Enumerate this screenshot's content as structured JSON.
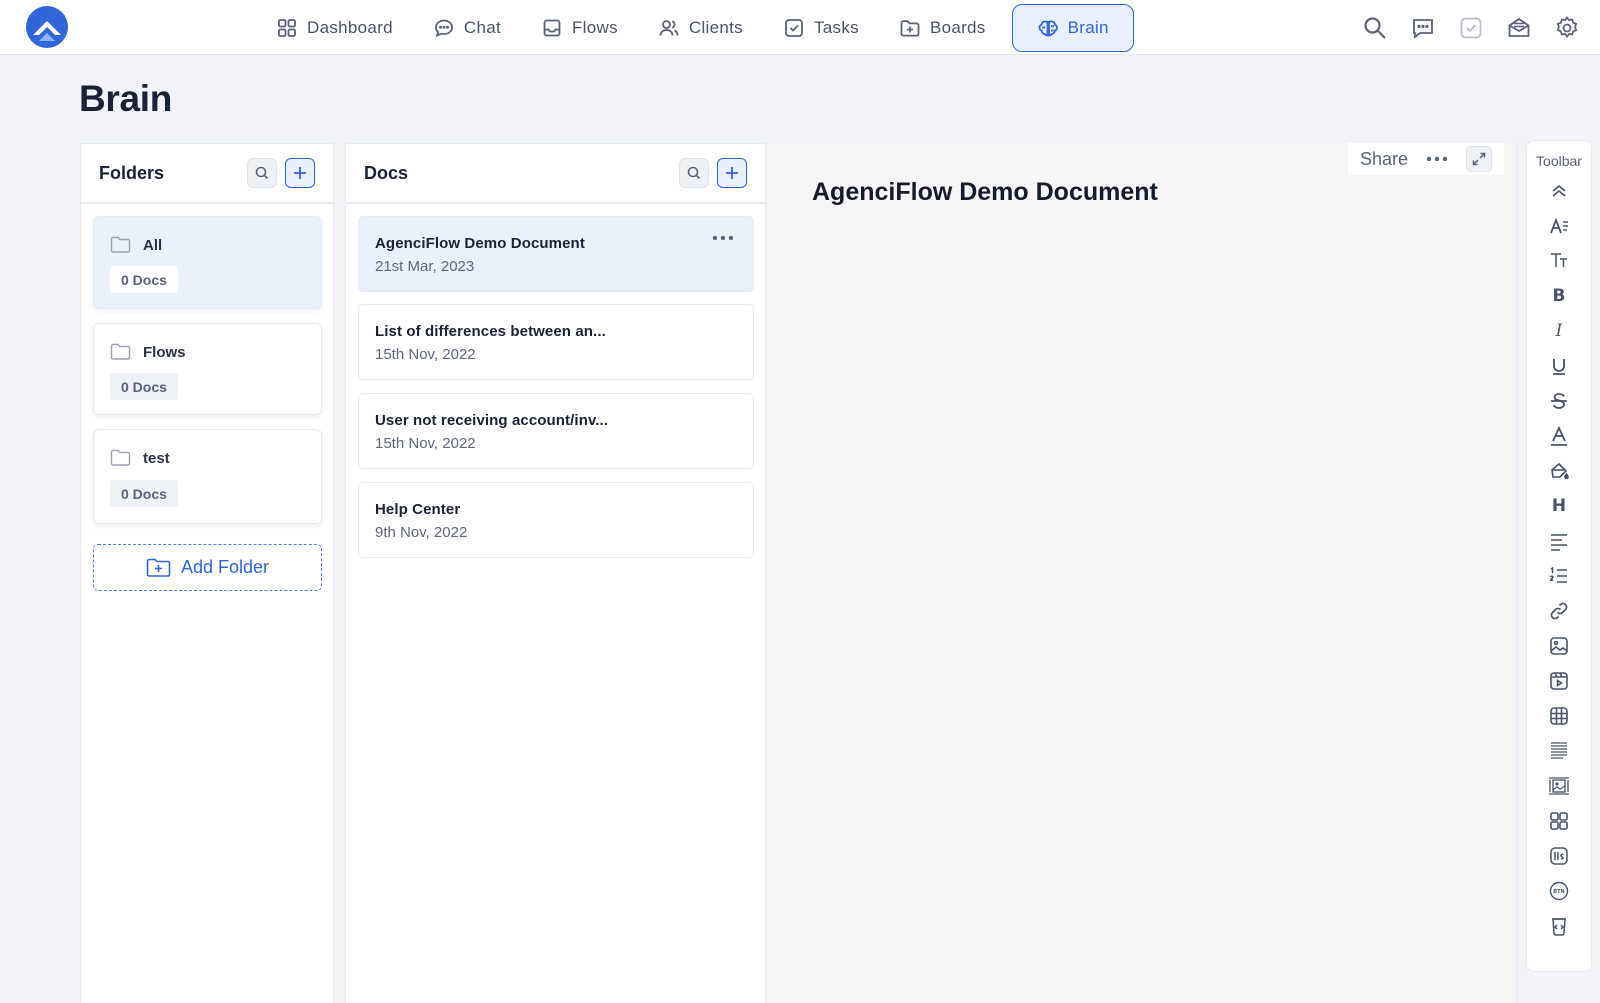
{
  "nav": {
    "items": [
      {
        "label": "Dashboard",
        "icon": "grid-icon"
      },
      {
        "label": "Chat",
        "icon": "chat-bubble-icon"
      },
      {
        "label": "Flows",
        "icon": "inbox-icon"
      },
      {
        "label": "Clients",
        "icon": "users-icon"
      },
      {
        "label": "Tasks",
        "icon": "checkbox-icon"
      },
      {
        "label": "Boards",
        "icon": "folder-plus-icon"
      },
      {
        "label": "Brain",
        "icon": "brain-icon",
        "active": true
      }
    ]
  },
  "page": {
    "title": "Brain"
  },
  "folders": {
    "title": "Folders",
    "items": [
      {
        "name": "All",
        "count": "0 Docs",
        "selected": true
      },
      {
        "name": "Flows",
        "count": "0 Docs"
      },
      {
        "name": "test",
        "count": "0 Docs"
      }
    ],
    "add_label": "Add Folder"
  },
  "docs": {
    "title": "Docs",
    "items": [
      {
        "title": "AgenciFlow Demo Document",
        "date": "21st Mar, 2023",
        "selected": true
      },
      {
        "title": "List of differences between an...",
        "date": "15th Nov, 2022"
      },
      {
        "title": "User not receiving account/inv...",
        "date": "15th Nov, 2022"
      },
      {
        "title": "Help Center",
        "date": "9th Nov, 2022"
      }
    ]
  },
  "editor": {
    "share_label": "Share",
    "document_title": "AgenciFlow Demo Document"
  },
  "toolbar": {
    "label": "Toolbar",
    "bold": "B",
    "italic": "I",
    "heading": "H"
  },
  "colors": {
    "accent": "#2f66d8",
    "selected_bg": "#eaf1fc",
    "page_bg": "#f1f3f8"
  }
}
